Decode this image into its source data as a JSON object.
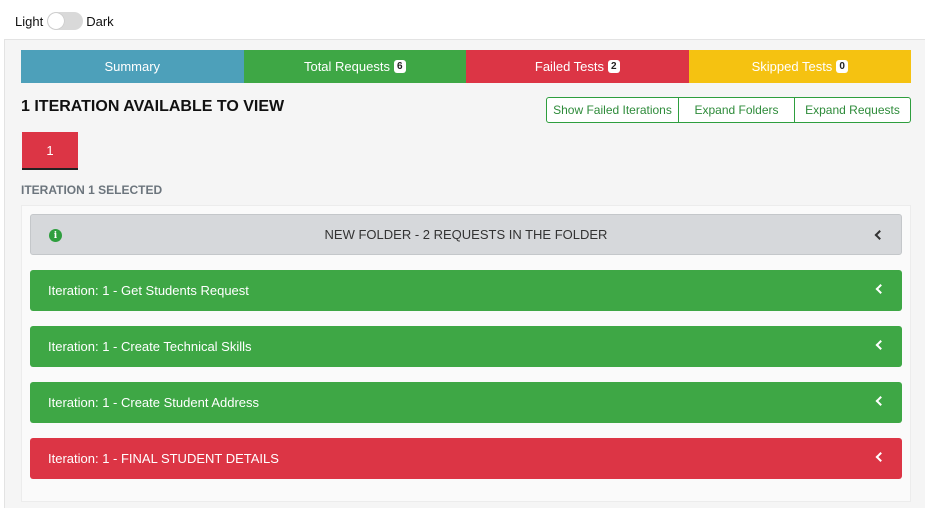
{
  "theme_toggle": {
    "light_label": "Light",
    "dark_label": "Dark"
  },
  "colors": {
    "summary": "#4da0ba",
    "success": "#3ea745",
    "danger": "#dc3545",
    "warning": "#f5c211",
    "folder_bg": "#d6d8db"
  },
  "tabs": [
    {
      "label": "Summary",
      "badge": null
    },
    {
      "label": "Total Requests",
      "badge": "6"
    },
    {
      "label": "Failed Tests",
      "badge": "2"
    },
    {
      "label": "Skipped Tests",
      "badge": "0"
    }
  ],
  "iterations_heading": "1 ITERATION AVAILABLE TO VIEW",
  "buttons": {
    "show_failed": "Show Failed Iterations",
    "expand_folders": "Expand Folders",
    "expand_requests": "Expand Requests"
  },
  "iteration_tab": "1",
  "iteration_selected": "ITERATION 1 SELECTED",
  "folder": {
    "title": "NEW FOLDER - 2 REQUESTS IN THE FOLDER",
    "icon": "info-icon"
  },
  "requests": [
    {
      "label": "Iteration: 1 - Get Students Request",
      "status": "passed"
    },
    {
      "label": "Iteration: 1 - Create Technical Skills",
      "status": "passed"
    },
    {
      "label": "Iteration: 1 - Create Student Address",
      "status": "passed"
    },
    {
      "label": "Iteration: 1 - FINAL STUDENT DETAILS",
      "status": "failed"
    }
  ]
}
